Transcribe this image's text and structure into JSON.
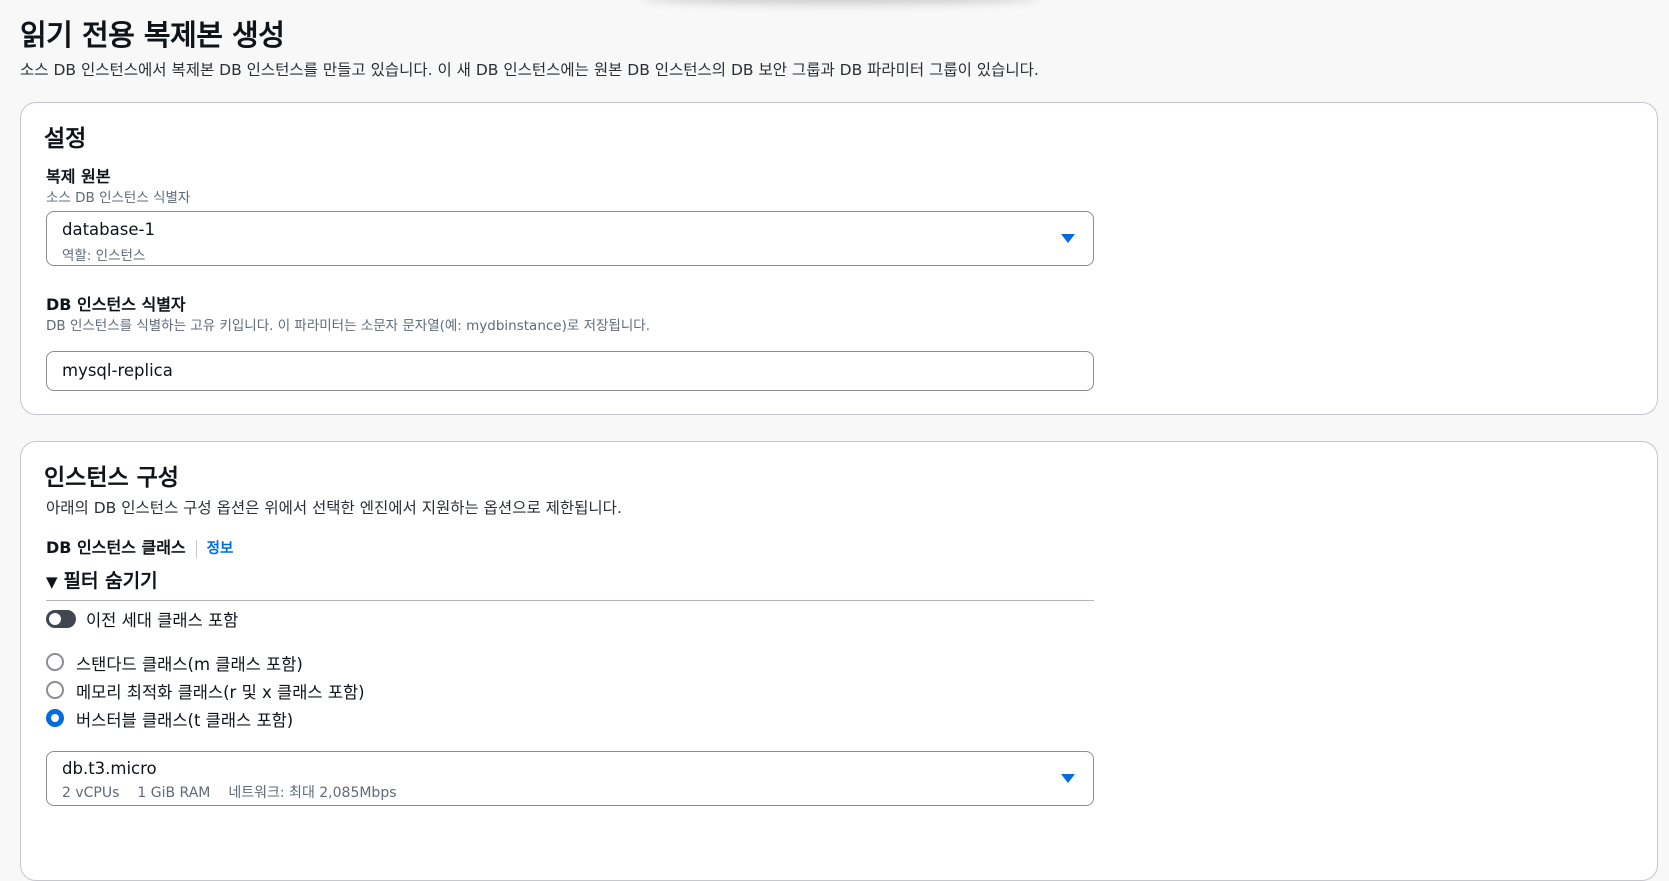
{
  "page": {
    "title": "읽기 전용 복제본 생성",
    "description": "소스 DB 인스턴스에서 복제본 DB 인스턴스를 만들고 있습니다. 이 새 DB 인스턴스에는 원본 DB 인스턴스의 DB 보안 그룹과 DB 파라미터 그룹이 있습니다."
  },
  "settings": {
    "title": "설정",
    "source": {
      "label": "복제 원본",
      "description": "소스 DB 인스턴스 식별자",
      "value": "database-1",
      "sub": "역할: 인스턴스"
    },
    "identifier": {
      "label": "DB 인스턴스 식별자",
      "description": "DB 인스턴스를 식별하는 고유 키입니다. 이 파라미터는 소문자 문자열(예: mydbinstance)로 저장됩니다.",
      "value": "mysql-replica"
    }
  },
  "instance_config": {
    "title": "인스턴스 구성",
    "description": "아래의 DB 인스턴스 구성 옵션은 위에서 선택한 엔진에서 지원하는 옵션으로 제한됩니다.",
    "class_label": "DB 인스턴스 클래스",
    "info_link": "정보",
    "filter_toggle": "필터 숨기기",
    "filter_arrow": "▼",
    "previous_gen_label": "이전 세대 클래스 포함",
    "previous_gen_enabled": false,
    "options": [
      {
        "label": "스탠다드 클래스(m 클래스 포함)",
        "selected": false
      },
      {
        "label": "메모리 최적화 클래스(r 및 x 클래스 포함)",
        "selected": false
      },
      {
        "label": "버스터블 클래스(t 클래스 포함)",
        "selected": true
      }
    ],
    "selected_class": {
      "value": "db.t3.micro",
      "vcpus": "2 vCPUs",
      "ram": "1 GiB RAM",
      "network": "네트워크: 최대 2,085Mbps"
    }
  },
  "colors": {
    "accent": "#006ce0",
    "border": "#8c8c94",
    "toggle_off": "#424650",
    "background": "#f8f8f8"
  }
}
